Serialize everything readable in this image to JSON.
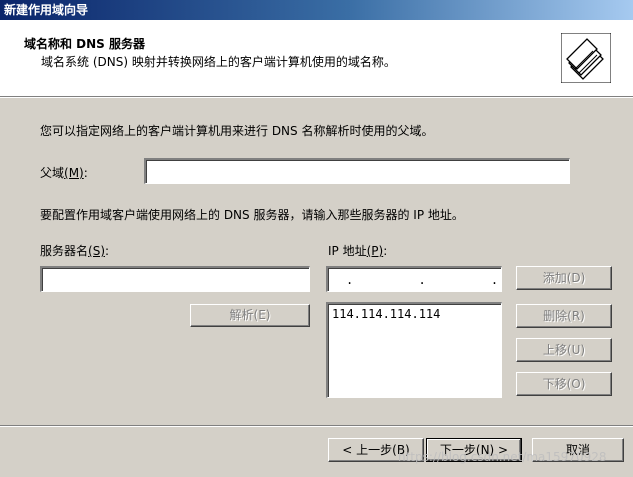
{
  "window": {
    "title": "新建作用域向导"
  },
  "header": {
    "title": "域名称和 DNS 服务器",
    "subtitle": "域名系统 (DNS) 映射并转换网络上的客户端计算机使用的域名称。",
    "icon": "folders-wizard-icon"
  },
  "body": {
    "intro": "您可以指定网络上的客户端计算机用来进行 DNS 名称解析时使用的父域。",
    "parent_domain": {
      "label": "父域",
      "hotkey": "(M)",
      "suffix": ":",
      "value": ""
    },
    "dns_instruction": "要配置作用域客户端使用网络上的 DNS 服务器，请输入那些服务器的 IP 地址。",
    "server_name": {
      "label": "服务器名",
      "hotkey": "(S)",
      "suffix": ":",
      "value": ""
    },
    "resolve_button": "解析(E)",
    "ip_address": {
      "label": "IP 地址",
      "hotkey": "(P)",
      "suffix": ":",
      "value": ". . ."
    },
    "ip_list": [
      "114.114.114.114"
    ],
    "buttons": {
      "add": "添加(D)",
      "remove": "删除(R)",
      "up": "上移(U)",
      "down": "下移(O)"
    }
  },
  "footer": {
    "back": "< 上一步(B)",
    "next": "下一步(N) >",
    "cancel": "取消"
  },
  "watermark": "https://blog.csdn.net/ma15970928"
}
